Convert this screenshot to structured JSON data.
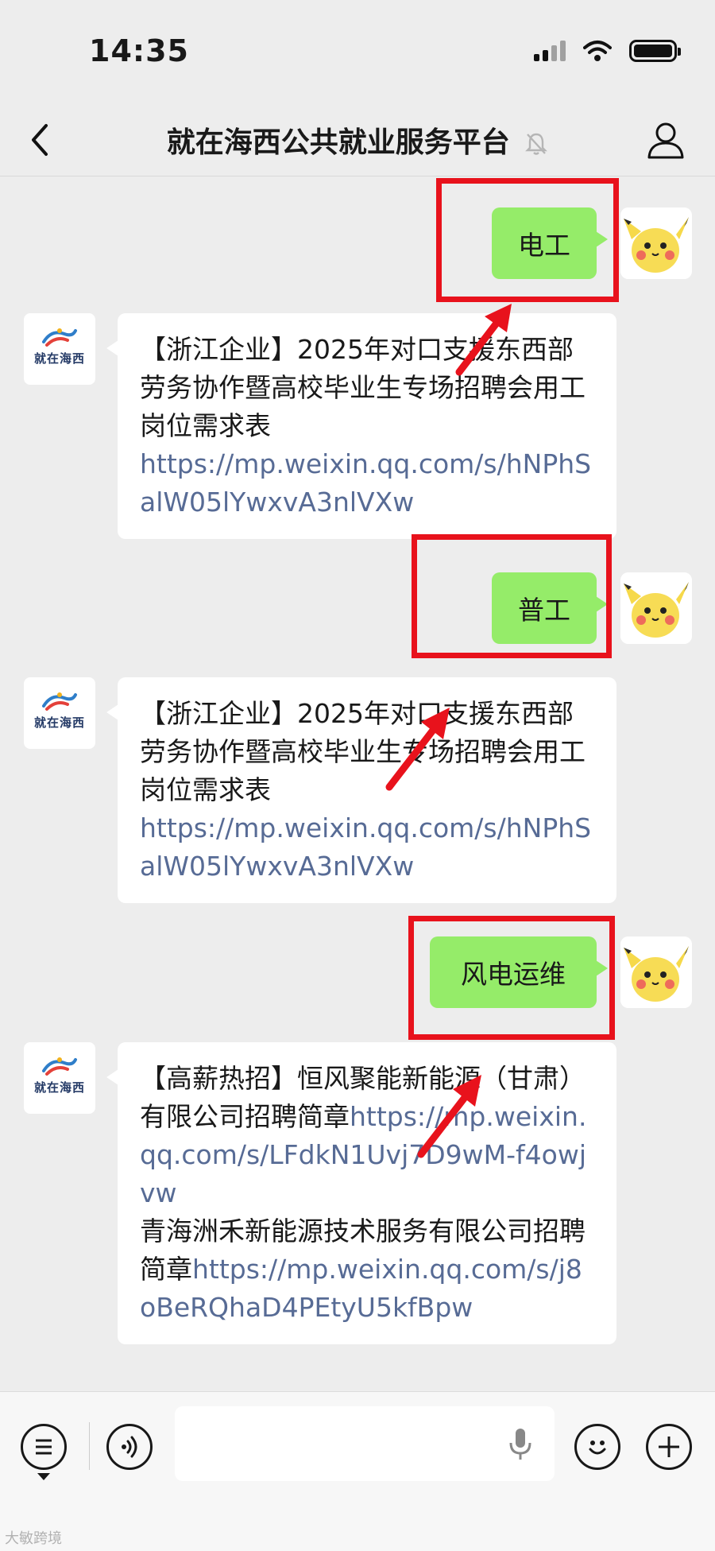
{
  "status_bar": {
    "time": "14:35"
  },
  "nav": {
    "title": "就在海西公共就业服务平台"
  },
  "avatar_bot": {
    "logo_text": "就在海西"
  },
  "messages": [
    {
      "from": "me",
      "text": "电工"
    },
    {
      "from": "account",
      "title": "【浙江企业】2025年对口支援东西部劳务协作暨高校毕业生专场招聘会用工岗位需求表",
      "link": "https://mp.weixin.qq.com/s/hNPhSalW05lYwxvA3nlVXw"
    },
    {
      "from": "me",
      "text": "普工"
    },
    {
      "from": "account",
      "title": "【浙江企业】2025年对口支援东西部劳务协作暨高校毕业生专场招聘会用工岗位需求表",
      "link": "https://mp.weixin.qq.com/s/hNPhSalW05lYwxvA3nlVXw"
    },
    {
      "from": "me",
      "text": "风电运维"
    },
    {
      "from": "account",
      "item1_title": "【高薪热招】恒风聚能新能源（甘肃）有限公司招聘简章",
      "item1_link": "https://mp.weixin.qq.com/s/LFdkN1Uvj7D9wM-f4owjvw",
      "item2_title": "青海洲禾新能源技术服务有限公司招聘简章",
      "item2_link": "https://mp.weixin.qq.com/s/j8oBeRQhaD4PEtyU5kfBpw"
    }
  ],
  "watermark": "大敏跨境",
  "colors": {
    "sent_bubble": "#95ec69",
    "link": "#576b95",
    "highlight": "#e8121c",
    "background": "#ededed"
  }
}
